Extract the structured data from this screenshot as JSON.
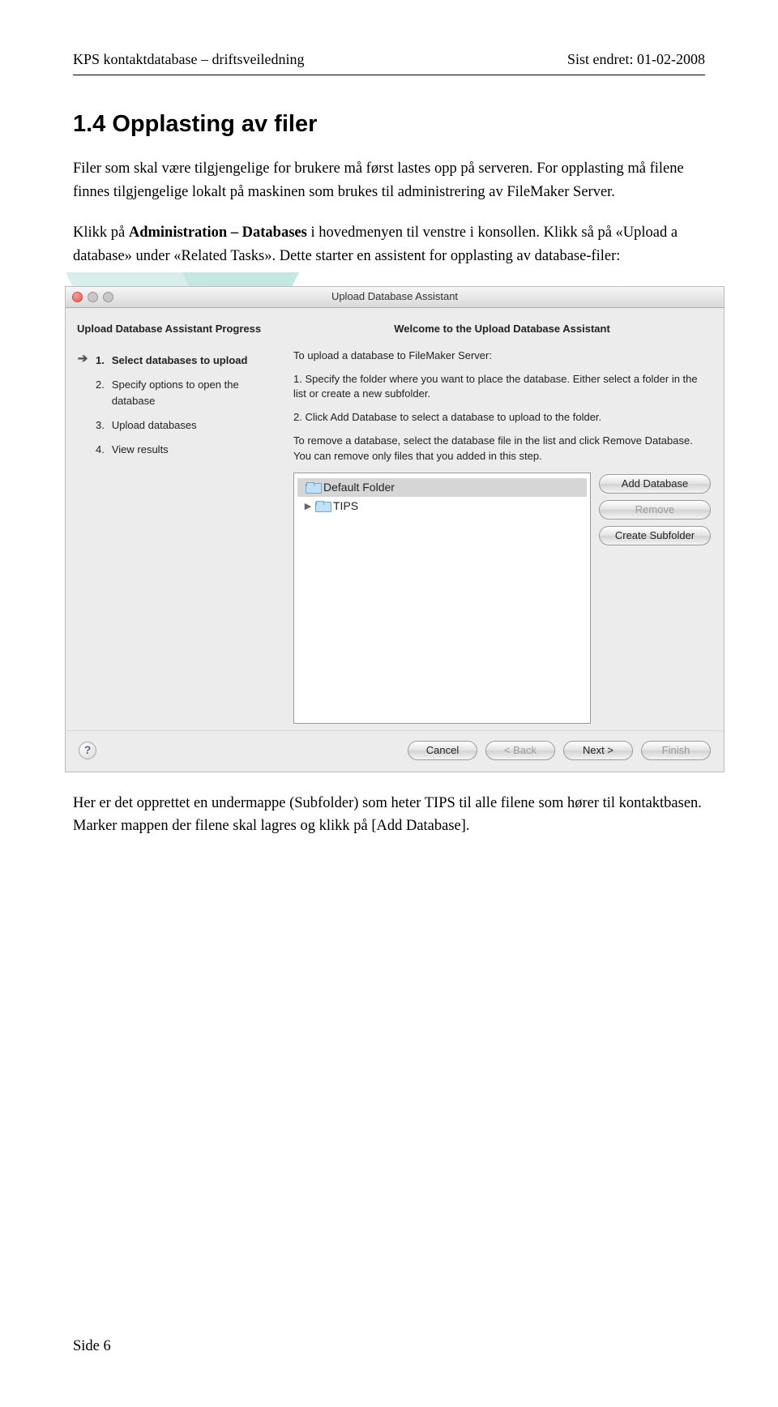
{
  "header": {
    "left": "KPS kontaktdatabase – driftsveiledning",
    "right": "Sist endret: 01-02-2008"
  },
  "section": {
    "title": "1.4  Opplasting av filer",
    "para1": "Filer som skal være tilgjengelige for brukere må først lastes opp på serveren. For opplasting må filene finnes tilgjengelige lokalt på maskinen som brukes til administrering av FileMaker Server.",
    "para2_a": "Klikk på ",
    "para2_b": "Administration – Databases",
    "para2_c": " i hovedmenyen til venstre i konsollen. Klikk så på «Upload a database» under «Related Tasks». Dette starter en assistent for opplasting av database-filer:",
    "para3": "Her er det opprettet en undermappe (Subfolder) som heter TIPS til alle filene som hører til kontaktbasen. Marker mappen der filene skal lagres og klikk på [Add Database]."
  },
  "dialog": {
    "title": "Upload Database Assistant",
    "sidebar_title": "Upload Database Assistant Progress",
    "steps": [
      {
        "num": "1.",
        "label": "Select databases to upload",
        "active": true
      },
      {
        "num": "2.",
        "label": "Specify options to open the database",
        "active": false
      },
      {
        "num": "3.",
        "label": "Upload databases",
        "active": false
      },
      {
        "num": "4.",
        "label": "View results",
        "active": false
      }
    ],
    "main_title": "Welcome to the Upload Database Assistant",
    "intro": "To upload a database to FileMaker Server:",
    "step1_text": "1.  Specify the folder where you want to place the database. Either select a folder in the list or create a new subfolder.",
    "step2_text": "2.  Click Add Database to select a database to upload to the folder.",
    "remove_text": "To remove a database, select the database file in the list and click Remove Database. You can remove only files that you added in this step.",
    "tree": {
      "root": "Default Folder",
      "child": "TIPS"
    },
    "right_buttons": {
      "add": "Add Database",
      "remove": "Remove",
      "create": "Create Subfolder"
    },
    "footer_buttons": {
      "cancel": "Cancel",
      "back": "< Back",
      "next": "Next >",
      "finish": "Finish"
    }
  },
  "footer": {
    "page": "Side 6"
  }
}
